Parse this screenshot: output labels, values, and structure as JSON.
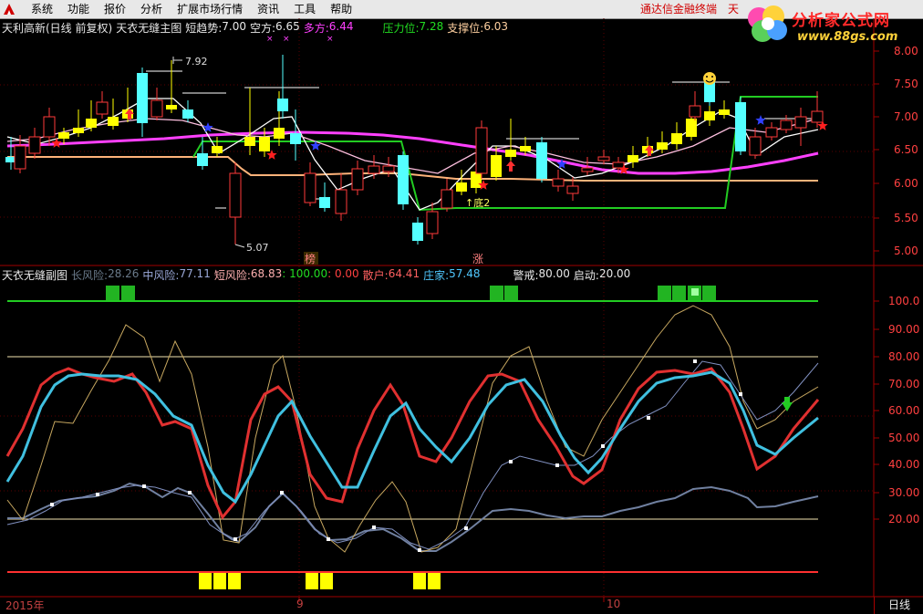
{
  "menu": {
    "items": [
      "系统",
      "功能",
      "报价",
      "分析",
      "扩展市场行情",
      "资讯",
      "工具",
      "帮助"
    ],
    "promo_link": "通达信金融终端",
    "promo_link2": "天"
  },
  "brand": {
    "title": "分析家公式网",
    "url": "www.88gs.com"
  },
  "main_header": {
    "stock": "天利高新(日线 前复权)",
    "indicator": "天衣无缝主图",
    "short_trend_label": "短趋势:",
    "short_trend_value": "7.00",
    "bear_label": "空方:",
    "bear_value": "6.65",
    "bull_label": "多方:",
    "bull_value": "6.44",
    "pressure_label": "压力位:",
    "pressure_value": "7.28",
    "support_label": "支撑位:",
    "support_value": "6.03"
  },
  "main_chart": {
    "y_ticks": [
      "8.00",
      "7.50",
      "7.00",
      "6.50",
      "6.00",
      "5.50",
      "5.00"
    ],
    "high_label": "7.92",
    "low_label": "5.07",
    "bottom_label": "↑底2",
    "tag_up": "涨",
    "tag_hot": "榜"
  },
  "sub_header": {
    "title": "天衣无缝副图",
    "long_risk_label": "长风险:",
    "long_risk_value": "28.26",
    "mid_risk_label": "中风险:",
    "mid_risk_value": "77.11",
    "short_risk_label": "短风险:",
    "short_risk_value": "68.83",
    "v100": ": 100.00",
    "v0": ": 0.00",
    "retail_label": "散户:",
    "retail_value": "64.41",
    "dealer_label": "庄家:",
    "dealer_value": "57.48",
    "warn_label": "警戒:",
    "warn_value": "80.00",
    "start_label": "启动:",
    "start_value": "20.00"
  },
  "sub_chart": {
    "y_ticks": [
      "100.0",
      "90.00",
      "80.00",
      "70.00",
      "60.00",
      "50.00",
      "40.00",
      "30.00",
      "20.00"
    ]
  },
  "x_axis": {
    "labels": [
      "2015年",
      "9",
      "10"
    ],
    "period": "日线"
  },
  "colors": {
    "background": "#000000",
    "up": "#ff3a3a",
    "down": "#54ffff",
    "grid": "#a00000",
    "magenta": "#ff40ff",
    "green": "#22cc22",
    "yellow": "#ffff00",
    "orange": "#ffb37a"
  }
}
